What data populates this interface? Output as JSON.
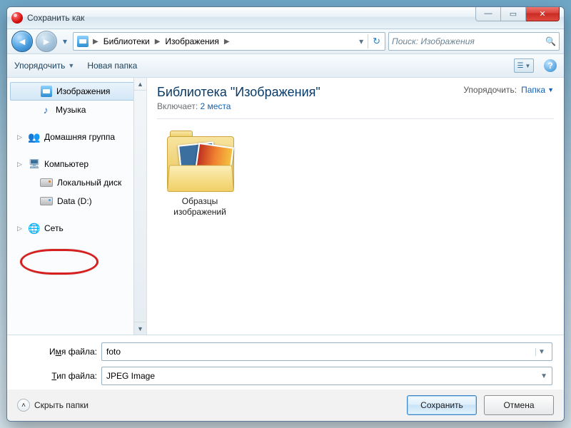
{
  "window": {
    "title": "Сохранить как"
  },
  "nav": {
    "breadcrumb": [
      "Библиотеки",
      "Изображения"
    ],
    "search_placeholder": "Поиск: Изображения"
  },
  "toolbar": {
    "organize": "Упорядочить",
    "new_folder": "Новая папка"
  },
  "sidebar": {
    "items": [
      {
        "label": "Изображения",
        "icon": "library",
        "selected": true,
        "indent": true
      },
      {
        "label": "Музыка",
        "icon": "music",
        "indent": true
      },
      {
        "label": "",
        "spacer": true
      },
      {
        "label": "Домашняя группа",
        "icon": "homegroup",
        "expandable": true
      },
      {
        "label": "",
        "spacer": true
      },
      {
        "label": "Компьютер",
        "icon": "computer",
        "expandable": true
      },
      {
        "label": "Локальный диск",
        "icon": "drive-sys",
        "indent": true
      },
      {
        "label": "Data (D:)",
        "icon": "drive",
        "indent": true,
        "highlighted": true
      },
      {
        "label": "",
        "spacer": true
      },
      {
        "label": "Сеть",
        "icon": "network",
        "expandable": true
      }
    ]
  },
  "content": {
    "library_title": "Библиотека \"Изображения\"",
    "includes_label": "Включает:",
    "includes_link": "2 места",
    "sort_label": "Упорядочить:",
    "sort_value": "Папка",
    "folders": [
      {
        "name": "Образцы изображений"
      }
    ]
  },
  "fields": {
    "filename_label_pre": "И",
    "filename_label_u": "м",
    "filename_label_post": "я файла:",
    "filename_value": "foto",
    "filetype_label_pre": "",
    "filetype_label_u": "Т",
    "filetype_label_post": "ип файла:",
    "filetype_value": "JPEG Image"
  },
  "footer": {
    "hide_folders": "Скрыть папки",
    "save": "Сохранить",
    "cancel": "Отмена"
  }
}
